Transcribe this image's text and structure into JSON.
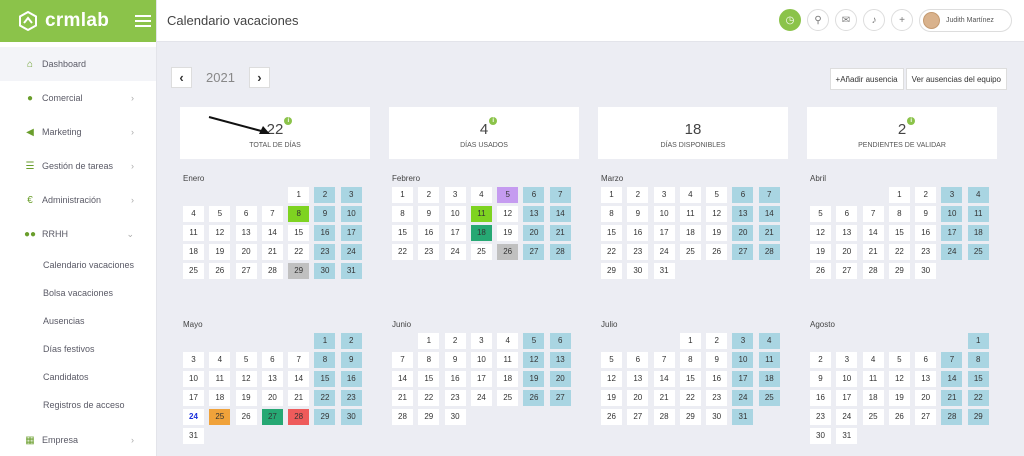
{
  "brand": "crmlab",
  "nav": {
    "top": [
      {
        "label": "Dashboard",
        "icon": "home-icon"
      },
      {
        "label": "Comercial",
        "icon": "user-icon"
      },
      {
        "label": "Marketing",
        "icon": "megaphone-icon"
      },
      {
        "label": "Gestión de tareas",
        "icon": "tasks-icon"
      },
      {
        "label": "Administración",
        "icon": "euro-icon"
      },
      {
        "label": "RRHH",
        "icon": "users-icon"
      }
    ],
    "sub": [
      "Calendario vacaciones",
      "Bolsa vacaciones",
      "Ausencias",
      "Días festivos",
      "Candidatos",
      "Registros de acceso"
    ],
    "bottom": {
      "label": "Empresa",
      "icon": "building-icon"
    }
  },
  "header": {
    "title": "Calendario vacaciones",
    "user_name": "Judith Martínez"
  },
  "year": "2021",
  "actions": {
    "add": "+Añadir ausencia",
    "view": "Ver ausencias del equipo"
  },
  "stats": [
    {
      "value": "22",
      "label": "TOTAL DE DÍAS"
    },
    {
      "value": "4",
      "label": "DÍAS USADOS"
    },
    {
      "value": "18",
      "label": "DÍAS DISPONIBLES"
    },
    {
      "value": "2",
      "label": "PENDIENTES DE VALIDAR"
    }
  ],
  "colors": {
    "accent": "#8bc34a",
    "weekend": "#a9d5e2",
    "approved": "#7ed321",
    "taken": "#26a873",
    "pending": "#c59bf0",
    "holiday": "#c0c0c0",
    "orange": "#f0a23a",
    "red": "#ee5b5b"
  },
  "months": [
    {
      "name": "Enero",
      "offset": 4,
      "days": 31,
      "special": {
        "8": "lime",
        "29": "gray"
      }
    },
    {
      "name": "Febrero",
      "offset": 0,
      "days": 28,
      "special": {
        "5": "purple",
        "11": "lime",
        "18": "teal",
        "26": "gray"
      }
    },
    {
      "name": "Marzo",
      "offset": 0,
      "days": 31,
      "special": {}
    },
    {
      "name": "Abril",
      "offset": 3,
      "days": 30,
      "special": {}
    },
    {
      "name": "Mayo",
      "offset": 5,
      "days": 31,
      "special": {
        "24": "today",
        "25": "orange",
        "27": "teal",
        "28": "red"
      }
    },
    {
      "name": "Junio",
      "offset": 1,
      "days": 30,
      "special": {}
    },
    {
      "name": "Julio",
      "offset": 3,
      "days": 31,
      "special": {}
    },
    {
      "name": "Agosto",
      "offset": 6,
      "days": 31,
      "special": {}
    }
  ]
}
